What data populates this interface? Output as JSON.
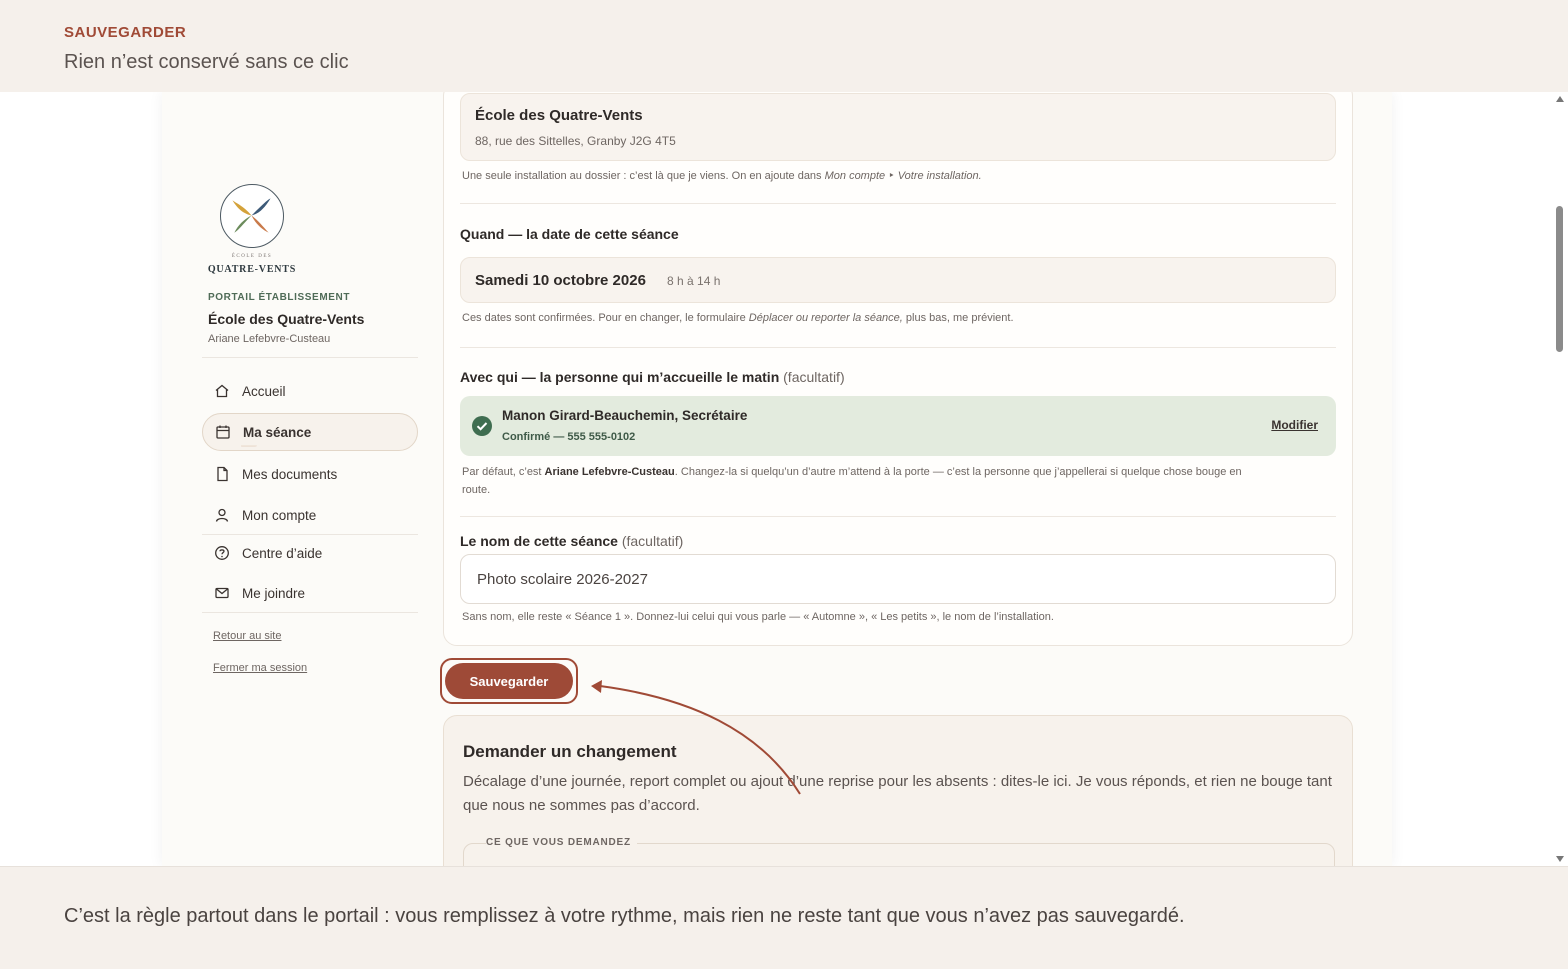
{
  "annotation": {
    "kicker": "SAUVEGARDER",
    "subtitle": "Rien n’est conservé sans ce clic",
    "footer_note": "C’est la règle partout dans le portail : vous remplissez à votre rythme, mais rien ne reste tant que vous n’avez pas sauvegardé."
  },
  "sidebar": {
    "logo_small": "ÉCOLE DES",
    "logo_word": "QUATRE-VENTS",
    "portal_label": "PORTAIL ÉTABLISSEMENT",
    "school_name": "École des Quatre-Vents",
    "user_name": "Ariane Lefebvre-Custeau",
    "items": [
      {
        "label": "Accueil",
        "icon": "home-icon"
      },
      {
        "label": "Ma séance",
        "icon": "calendar-icon",
        "active": true
      },
      {
        "label": "Mes documents",
        "icon": "document-icon"
      },
      {
        "label": "Mon compte",
        "icon": "user-icon"
      },
      {
        "label": "Centre d’aide",
        "icon": "help-icon"
      },
      {
        "label": "Me joindre",
        "icon": "mail-icon"
      }
    ],
    "back_link": "Retour au site",
    "logout_link": "Fermer ma session"
  },
  "where": {
    "title": "École des Quatre-Vents",
    "address": "88, rue des Sittelles, Granby J2G 4T5",
    "help_prefix": "Une seule installation au dossier : c’est là que je viens. On en ajoute dans ",
    "help_em": "Mon compte ‣ Votre installation."
  },
  "when": {
    "label": "Quand — la date de cette séance",
    "date": "Samedi 10 octobre 2026",
    "time": "8 h à 14 h",
    "help_prefix": "Ces dates sont confirmées. Pour en changer, le formulaire ",
    "help_em": "Déplacer ou reporter la séance,",
    "help_suffix": " plus bas, me prévient."
  },
  "who": {
    "label": "Avec qui — la personne qui m’accueille le matin",
    "optional": "(facultatif)",
    "contact_name": "Manon Girard-Beauchemin, Secrétaire",
    "contact_status": "Confirmé — 555 555-0102",
    "modify": "Modifier",
    "help_prefix": "Par défaut, c’est ",
    "help_bold": "Ariane Lefebvre-Custeau",
    "help_suffix": ". Changez-la si quelqu’un d’autre m’attend à la porte — c’est la personne que j’appellerai si quelque chose bouge en",
    "help_line2": "route."
  },
  "name": {
    "label": "Le nom de cette séance",
    "optional": "(facultatif)",
    "value": "Photo scolaire 2026-2027",
    "help": "Sans nom, elle reste « Séance 1 ». Donnez-lui celui qui vous parle — « Automne », « Les petits », le nom de l’installation."
  },
  "save_label": "Sauvegarder",
  "change": {
    "title": "Demander un changement",
    "description": "Décalage d’une journée, report complet ou ajout d’une reprise pour les absents : dites-le ici. Je vous réponds, et rien ne bouge tant que nous ne sommes pas d’accord.",
    "field_legend": "CE QUE VOUS DEMANDEZ"
  },
  "colors": {
    "accent": "#9e4a37",
    "sage": "#3f6d50",
    "banner_bg": "#f5f0eb"
  }
}
